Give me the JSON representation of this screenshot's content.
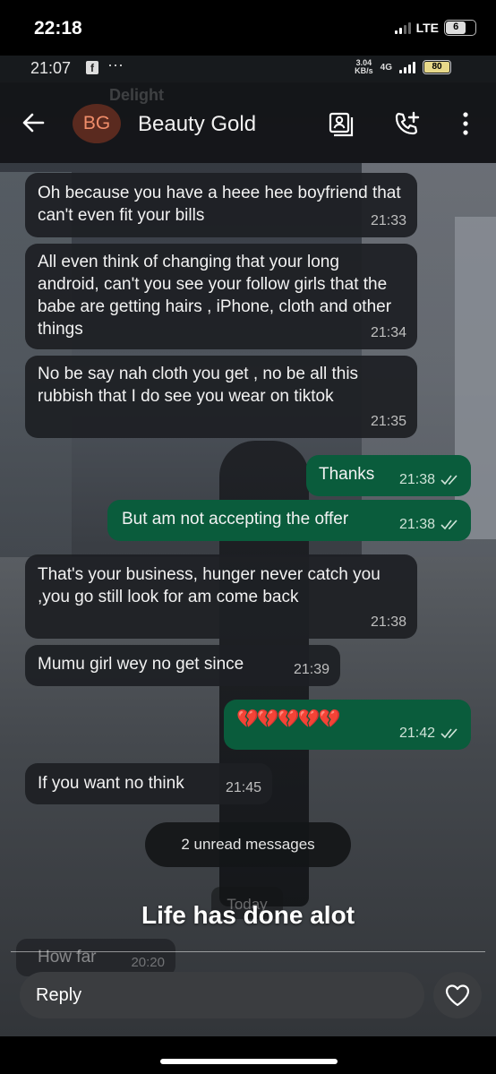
{
  "outer_status": {
    "time": "22:18",
    "network": "LTE",
    "battery": "6"
  },
  "inner_status": {
    "time": "21:07",
    "app_badge": "f",
    "dots": "···",
    "speed_top": "3.04",
    "speed_bottom": "KB/s",
    "net": "4G",
    "battery": "80"
  },
  "header": {
    "ghost_name": "Delight",
    "avatar_initials": "BG",
    "contact_name": "Beauty Gold"
  },
  "messages": [
    {
      "dir": "in",
      "text": "Oh because you have a heee hee boyfriend that can't even fit your bills",
      "time": "21:33"
    },
    {
      "dir": "in",
      "text": "All even think of changing that your long android, can't you see your follow girls that the babe are getting hairs , iPhone, cloth and other things",
      "time": "21:34"
    },
    {
      "dir": "in",
      "text": "No be say nah cloth you get , no be all this rubbish that I do see you wear on tiktok",
      "time": "21:35"
    },
    {
      "dir": "out",
      "text": "Thanks",
      "time": "21:38"
    },
    {
      "dir": "out",
      "text": "But am not accepting the offer",
      "time": "21:38"
    },
    {
      "dir": "in",
      "text": "That's your business, hunger never catch you ,you go still look for am come back",
      "time": "21:38"
    },
    {
      "dir": "in",
      "text": "Mumu girl wey no get since",
      "time": "21:39"
    },
    {
      "dir": "out",
      "text": "💔💔💔💔💔",
      "time": "21:42"
    },
    {
      "dir": "in",
      "text": "If you want no think",
      "time": "21:45"
    }
  ],
  "unread_pill": "2 unread messages",
  "today_label": "Today",
  "story_caption": "Life has done alot",
  "last_message": {
    "text": "How far",
    "time": "20:20"
  },
  "reply": {
    "placeholder": "Reply"
  },
  "colors": {
    "outgoing": "#0a5c3c",
    "incoming": "#1e2024",
    "avatar_bg": "#5a2a1f",
    "avatar_text": "#f08d6a"
  }
}
